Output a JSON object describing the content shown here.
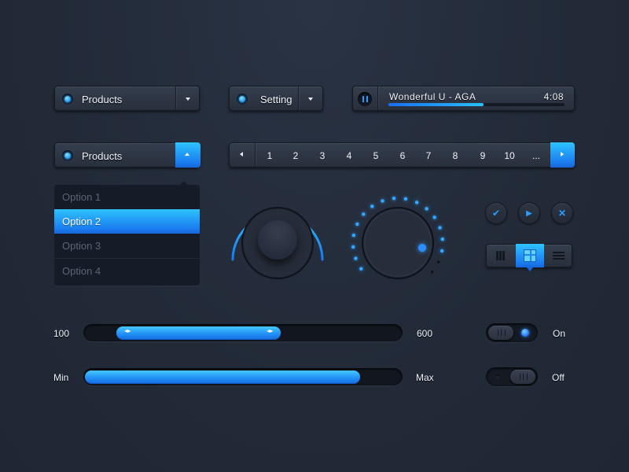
{
  "dropdown_products": {
    "label": "Products",
    "icon": "caret-down-icon"
  },
  "dropdown_setting": {
    "label": "Setting",
    "icon": "caret-down-icon"
  },
  "player": {
    "track": "Wonderful U - AGA",
    "time": "4:08",
    "progress": 0.54,
    "state": "playing"
  },
  "dropdown_open": {
    "label": "Products",
    "options": [
      "Option 1",
      "Option 2",
      "Option 3",
      "Option 4"
    ],
    "selected_index": 1
  },
  "pagination": {
    "pages": [
      "1",
      "2",
      "3",
      "4",
      "5",
      "6",
      "7",
      "8",
      "9",
      "10",
      "..."
    ],
    "prev_icon": "caret-left-icon",
    "next_icon": "caret-right-icon"
  },
  "knob_arc": {
    "value": 0.5
  },
  "knob_dots": {
    "lit": 16,
    "total": 18
  },
  "action_buttons": [
    "check",
    "play",
    "close"
  ],
  "view_switch": {
    "options": [
      "small-grid",
      "large-grid",
      "list"
    ],
    "active_index": 1
  },
  "range_slider": {
    "min_label": "100",
    "max_label": "600",
    "low": 0.1,
    "high": 0.62
  },
  "progress_slider": {
    "min_label": "Min",
    "max_label": "Max",
    "value": 0.87
  },
  "toggle_on": {
    "label": "On",
    "state": true
  },
  "toggle_off": {
    "label": "Off",
    "state": false
  },
  "colors": {
    "accent": "#1e8cf5",
    "accent_light": "#2ec3ff",
    "background": "#222a38"
  }
}
